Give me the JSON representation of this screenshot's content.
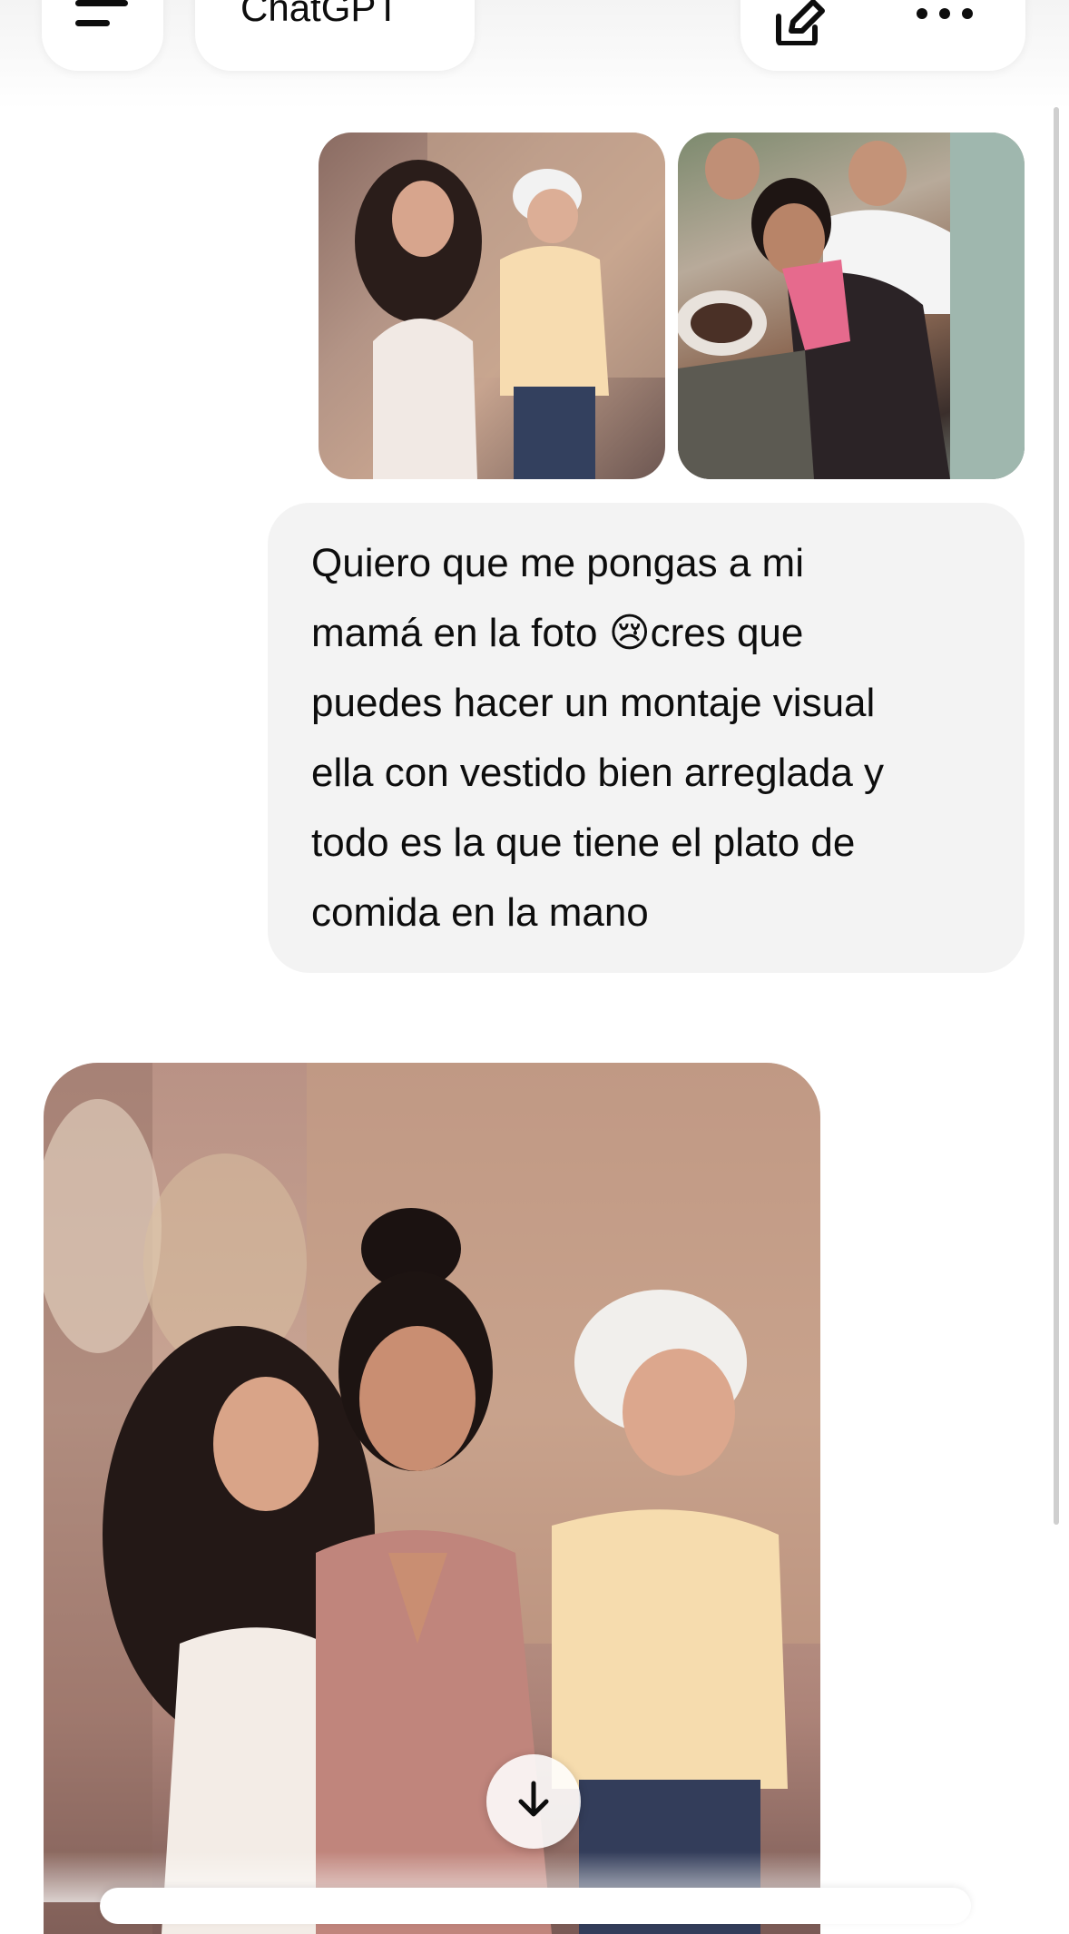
{
  "header": {
    "title": "ChatGPT",
    "menu_icon": "hamburger-menu-icon",
    "edit_icon": "new-chat-edit-icon",
    "more_icon": "more-options-icon"
  },
  "conversation": {
    "user_message": {
      "attachments": [
        {
          "icon": "photo",
          "description_hidden": true
        },
        {
          "icon": "photo",
          "description_hidden": true
        }
      ],
      "text": "Quiero que me pongas a mi\nmamá en la foto 😢cres que\npuedes hacer un montaje visual\nella con vestido bien arreglada y\ntodo es la que tiene el plato de\ncomida en la mano"
    },
    "assistant_message": {
      "generated_image": true
    }
  },
  "scroll_down_icon": "arrow-down-icon",
  "colors": {
    "bubble_bg": "#f3f3f3",
    "page_bg": "#ffffff",
    "text": "#0d0d0d"
  }
}
